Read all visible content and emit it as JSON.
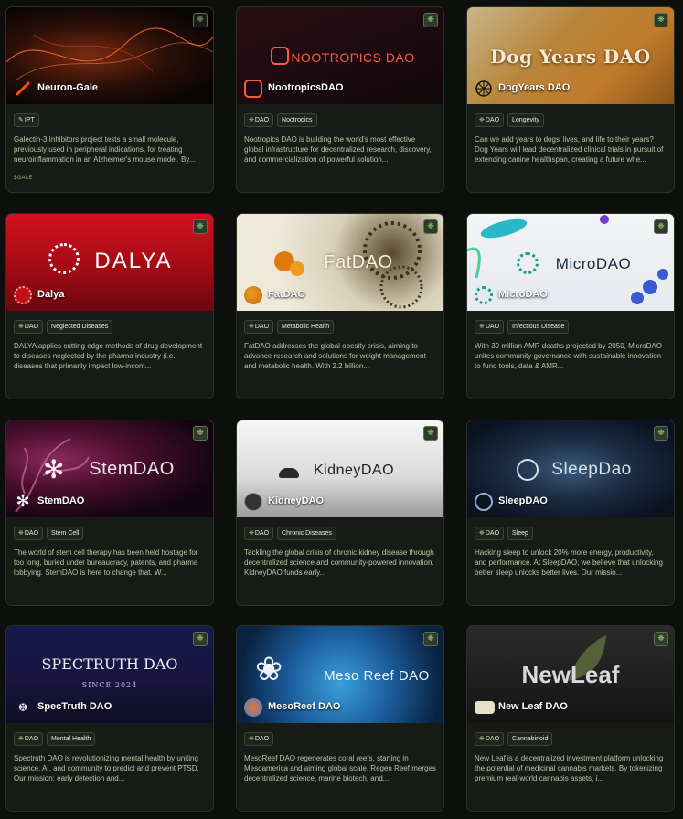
{
  "chain_icon": "❈",
  "cards": [
    {
      "name": "Neuron-Gale",
      "banner_text": "",
      "tag1": "IPT",
      "tag1_icon": "pen-icon",
      "tag2": "",
      "desc": "Galectin-3 Inhibitors project tests a small molecule, previously used in peripheral indications, for treating neuroinflammation in an Alzheimer's mouse model. By...",
      "token": "$GALE"
    },
    {
      "name": "NootropicsDAO",
      "banner_text": "NOOTROPICS DAO",
      "tag1": "DAO",
      "tag2": "Nootropics",
      "desc": "Nootropics DAO is building the world's most effective global infrastructure for decentralized research, discovery, and commercialization of powerful solution...",
      "token": ""
    },
    {
      "name": "DogYears DAO",
      "banner_text": "Dog Years DAO",
      "tag1": "DAO",
      "tag2": "Longevity",
      "desc": "Can we add years to dogs' lives, and life to their years? Dog Years will lead decentralized clinical trials in pursuit of extending canine healthspan, creating a future whe...",
      "token": ""
    },
    {
      "name": "Dalya",
      "banner_text": "DALYA",
      "tag1": "DAO",
      "tag2": "Neglected Diseases",
      "desc": "DALYA applies cutting edge methods of drug development to diseases neglected by the pharma industry (i.e. diseases that primarily impact low-incom...",
      "token": ""
    },
    {
      "name": "FatDAO",
      "banner_text": "FatDAO",
      "tag1": "DAO",
      "tag2": "Metabolic Health",
      "desc": "FatDAO addresses the global obesity crisis, aiming to advance research and solutions for weight management and metabolic health. With 2.2 billion...",
      "token": ""
    },
    {
      "name": "MicroDAO",
      "banner_text": "MicroDAO",
      "tag1": "DAO",
      "tag2": "Infectious Disease",
      "desc": "With 39 million AMR deaths projected by 2050, MicroDAO unites community governance with sustainable innovation to fund tools, data & AMR...",
      "token": ""
    },
    {
      "name": "StemDAO",
      "banner_text": "StemDAO",
      "tag1": "DAO",
      "tag2": "Stem Cell",
      "desc": "The world of stem cell therapy has been held hostage for too long, buried under bureaucracy, patents, and pharma lobbying. StemDAO is here to change that. W...",
      "token": ""
    },
    {
      "name": "KidneyDAO",
      "banner_text": "KidneyDAO",
      "tag1": "DAO",
      "tag2": "Chronic Diseases",
      "desc": "Tackling the global crisis of chronic kidney disease through decentralized science and community-powered innovation. KidneyDAO funds early...",
      "token": ""
    },
    {
      "name": "SleepDAO",
      "banner_text": "SleepDao",
      "tag1": "DAO",
      "tag2": "Sleep",
      "desc": "Hacking sleep to unlock 20% more energy, productivity, and performance. At SleepDAO, we believe that unlocking better sleep unlocks better lives. Our missio...",
      "token": ""
    },
    {
      "name": "SpecTruth DAO",
      "banner_text": "SPECTRUTH DAO",
      "banner_sub": "SINCE 2024",
      "tag1": "DAO",
      "tag2": "Mental Health",
      "desc": "Spectruth DAO is revolutionizing mental health by uniting science, AI, and community to predict and prevent PTSD. Our mission: early detection and...",
      "token": ""
    },
    {
      "name": "MesoReef DAO",
      "banner_text": "Meso Reef DAO",
      "tag1": "DAO",
      "tag2": "",
      "desc": "MesoReef DAO regenerates coral reefs, starting in Mesoamerica and aiming global scale. Regen Reef merges decentralized science, marine biotech, and...",
      "token": ""
    },
    {
      "name": "New Leaf DAO",
      "banner_text": "NewLeaf",
      "tag1": "DAO",
      "tag2": "Cannabinoid",
      "desc": "New Leaf is a decentralized investment platform unlocking the potential of medicinal cannabis markets. By tokenizing premium real-world cannabis assets, i...",
      "token": ""
    }
  ]
}
